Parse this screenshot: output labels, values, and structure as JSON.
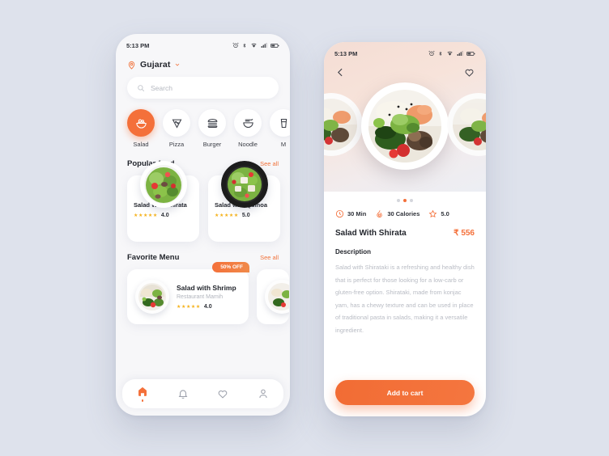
{
  "background_color": "#dee2ec",
  "accent_color": "#f4703a",
  "home": {
    "statusbar": {
      "time": "5:13 PM",
      "icons": [
        "alarm-icon",
        "bluetooth-icon",
        "wifi-icon",
        "signal-icon",
        "battery-icon"
      ]
    },
    "location": {
      "name": "Gujarat",
      "pin_icon": "location-pin-icon",
      "chevron_icon": "chevron-down-icon"
    },
    "search": {
      "placeholder": "Search",
      "icon": "search-icon"
    },
    "categories": [
      {
        "label": "Salad",
        "icon": "salad-bowl-icon",
        "active": true
      },
      {
        "label": "Pizza",
        "icon": "pizza-slice-icon",
        "active": false
      },
      {
        "label": "Burger",
        "icon": "burger-icon",
        "active": false
      },
      {
        "label": "Noodle",
        "icon": "noodle-bowl-icon",
        "active": false
      },
      {
        "label": "M",
        "icon": "drink-icon",
        "active": false
      }
    ],
    "popular": {
      "title": "Popular food",
      "see_all": "See all",
      "items": [
        {
          "name": "Salad With Shirata",
          "stars": "★★★★★",
          "rating": "4.0"
        },
        {
          "name": "Salad with Quinoa",
          "stars": "★★★★★",
          "rating": "5.0"
        }
      ]
    },
    "favorite": {
      "title": "Favorite Menu",
      "see_all": "See all",
      "items": [
        {
          "name": "Salad with Shrimp",
          "restaurant": "Restaurant Mamih",
          "stars": "★★★★★",
          "rating": "4.0",
          "badge": "50% OFF"
        }
      ]
    },
    "bottom_nav": [
      {
        "name": "home",
        "icon": "home-icon",
        "active": true
      },
      {
        "name": "notifications",
        "icon": "bell-icon",
        "active": false
      },
      {
        "name": "favorites",
        "icon": "heart-icon",
        "active": false
      },
      {
        "name": "profile",
        "icon": "user-icon",
        "active": false
      }
    ]
  },
  "detail": {
    "statusbar": {
      "time": "5:13 PM",
      "icons": [
        "alarm-icon",
        "bluetooth-icon",
        "wifi-icon",
        "signal-icon",
        "battery-icon"
      ]
    },
    "back_icon": "back-chevron-icon",
    "favorite_icon": "heart-icon",
    "carousel": {
      "dots": 3,
      "active_index": 1
    },
    "meta": [
      {
        "icon": "clock-icon",
        "text": "30 Min"
      },
      {
        "icon": "calories-icon",
        "text": "30 Calories"
      },
      {
        "icon": "star-icon",
        "text": "5.0"
      }
    ],
    "dish_title": "Salad With Shirata",
    "price": "₹ 556",
    "description_heading": "Description",
    "description": "Salad with Shirataki is a refreshing and healthy dish that is perfect for those looking for a low-carb or gluten-free option. Shirataki, made from konjac yam, has a chewy texture and can be used in place of traditional pasta in salads, making it a versatile ingredient.",
    "cart_button": "Add to cart"
  }
}
